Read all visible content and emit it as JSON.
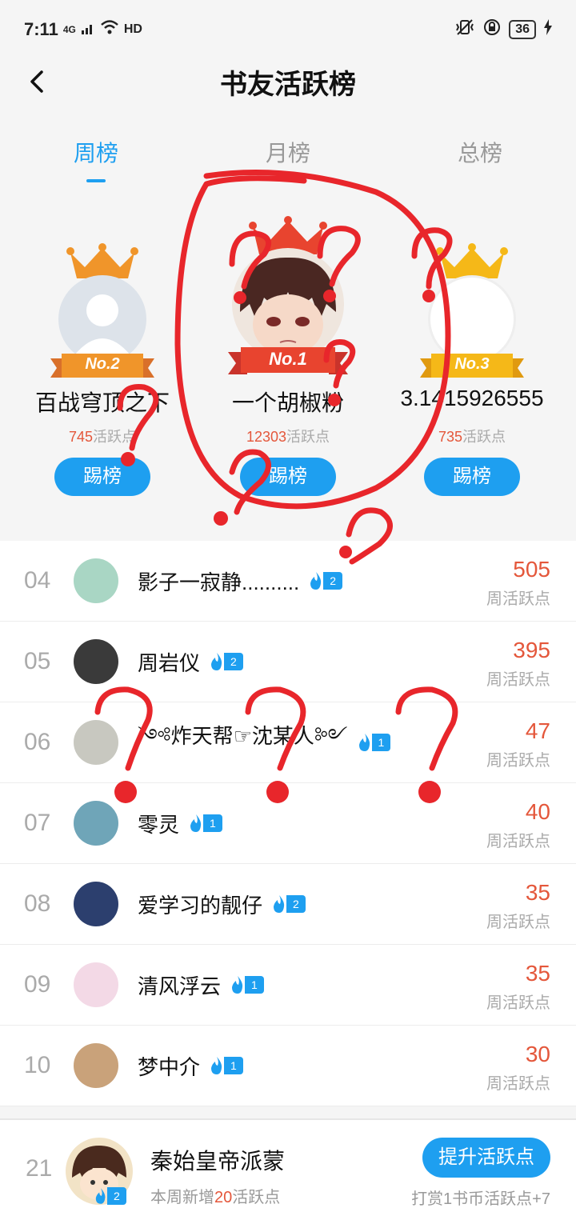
{
  "status_bar": {
    "time": "7:11",
    "signal": "4G",
    "hd": "HD",
    "battery": "36"
  },
  "header": {
    "title": "书友活跃榜"
  },
  "tabs": [
    {
      "label": "周榜",
      "active": true
    },
    {
      "label": "月榜",
      "active": false
    },
    {
      "label": "总榜",
      "active": false
    }
  ],
  "podium": {
    "first": {
      "badge": "No.1",
      "name": "一个胡椒粉",
      "points": "12303",
      "suffix": "活跃点",
      "button": "踢榜"
    },
    "second": {
      "badge": "No.2",
      "name": "百战穹顶之下",
      "points": "745",
      "suffix": "活跃点",
      "button": "踢榜"
    },
    "third": {
      "badge": "No.3",
      "name": "3.1415926555",
      "points": "735",
      "suffix": "活跃点",
      "button": "踢榜"
    }
  },
  "list": [
    {
      "rank": "04",
      "name": "影子一寂静..........",
      "level": "2",
      "score": "505",
      "label": "周活跃点",
      "avatar_color": "#a9d6c4"
    },
    {
      "rank": "05",
      "name": "周岩仪",
      "level": "2",
      "score": "395",
      "label": "周活跃点",
      "avatar_color": "#3a3a3a"
    },
    {
      "rank": "06",
      "name": "༺炸天帮☞沈某人༻",
      "level": "1",
      "score": "47",
      "label": "周活跃点",
      "avatar_color": "#c8c8c0"
    },
    {
      "rank": "07",
      "name": "零灵",
      "level": "1",
      "score": "40",
      "label": "周活跃点",
      "avatar_color": "#6fa5b8"
    },
    {
      "rank": "08",
      "name": "爱学习的靓仔",
      "level": "2",
      "score": "35",
      "label": "周活跃点",
      "avatar_color": "#2c3f6e"
    },
    {
      "rank": "09",
      "name": "清风浮云",
      "level": "1",
      "score": "35",
      "label": "周活跃点",
      "avatar_color": "#f3d9e6"
    },
    {
      "rank": "10",
      "name": "梦中介",
      "level": "1",
      "score": "30",
      "label": "周活跃点",
      "avatar_color": "#c9a27a"
    }
  ],
  "footer": {
    "rank": "21",
    "name": "秦始皇帝派蒙",
    "level": "2",
    "sub_prefix": "本周新增",
    "sub_num": "20",
    "sub_suffix": "活跃点",
    "button": "提升活跃点",
    "tip": "打赏1书币活跃点+7"
  },
  "colors": {
    "accent": "#1e9ff0",
    "score": "#e4573b",
    "scribble": "#e8262b"
  }
}
